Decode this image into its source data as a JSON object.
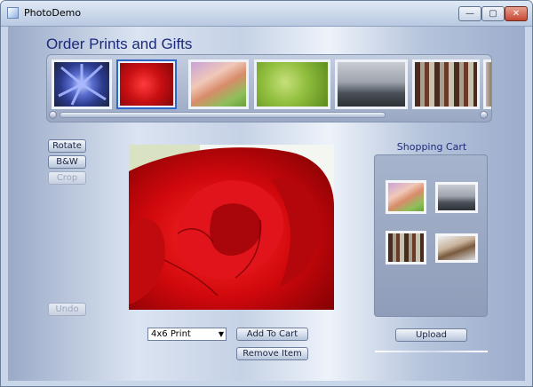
{
  "window": {
    "title": "PhotoDemo",
    "controls": {
      "minimize": "—",
      "maximize": "▢",
      "close": "✕"
    }
  },
  "heading": "Order Prints and Gifts",
  "thumbnails": [
    {
      "name": "blue-flower"
    },
    {
      "name": "red-rose",
      "selected": true
    },
    {
      "name": "pastel-leaf"
    },
    {
      "name": "green-leaf"
    },
    {
      "name": "pier-dock"
    },
    {
      "name": "redwood-forest"
    },
    {
      "name": "partial-image"
    }
  ],
  "scrollbar": {
    "position": 0,
    "visible_fraction": 0.78
  },
  "edit_buttons": {
    "rotate": "Rotate",
    "bw": "B&W",
    "crop": "Crop",
    "undo": "Undo"
  },
  "main_photo": {
    "name": "red-rose"
  },
  "print_select": {
    "value": "4x6 Print"
  },
  "actions": {
    "add_to_cart": "Add To Cart",
    "remove_item": "Remove Item",
    "upload": "Upload"
  },
  "cart": {
    "title": "Shopping Cart",
    "items": [
      "pastel-leaf",
      "pier-dock",
      "redwood-forest",
      "log-snow"
    ]
  },
  "colors": {
    "heading": "#1c2a7a",
    "selection_border": "#2f66c8",
    "close_button": "#c44733"
  }
}
